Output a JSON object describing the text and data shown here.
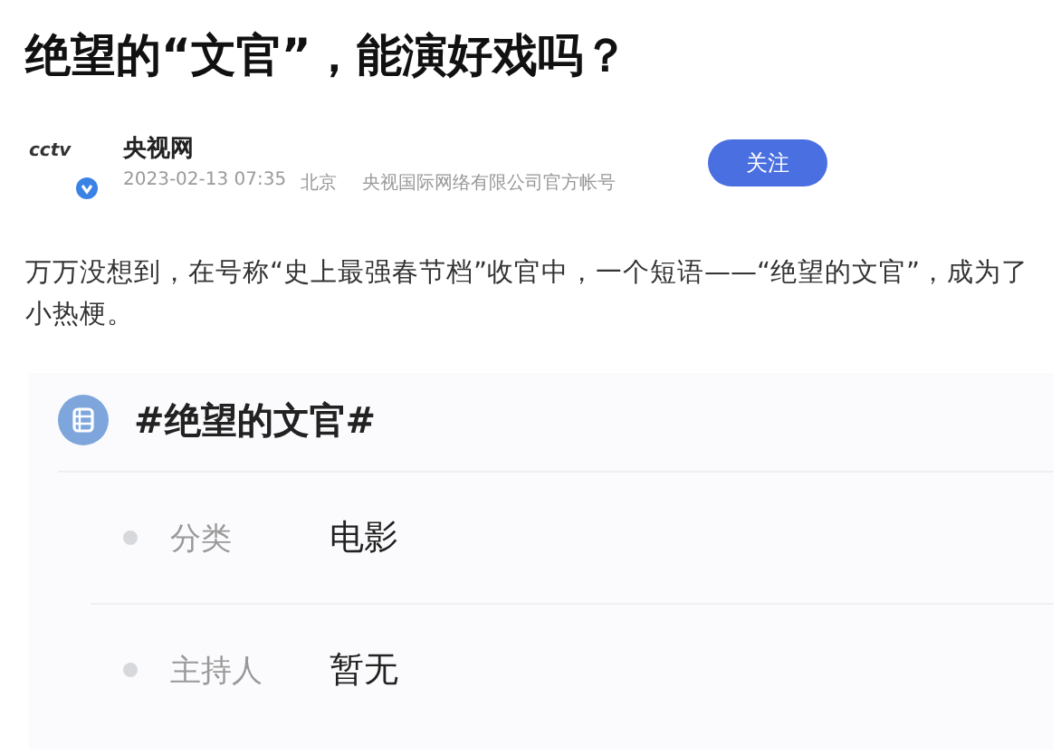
{
  "title": "绝望的“文官”，能演好戏吗？",
  "author": {
    "logo_text": "cctv",
    "name": "央视网",
    "verified": true,
    "time": "2023-02-13 07:35",
    "location": "北京",
    "description": "央视国际网络有限公司官方帐号",
    "follow_button": "关注"
  },
  "paragraph": "万万没想到，在号称“史上最强春节档”收官中，一个短语——“绝望的文官”，成为了小热梗。",
  "topic": {
    "title": "#绝望的文官#",
    "fields": [
      {
        "label": "分类",
        "value": "电影"
      },
      {
        "label": "主持人",
        "value": "暂无"
      }
    ]
  }
}
